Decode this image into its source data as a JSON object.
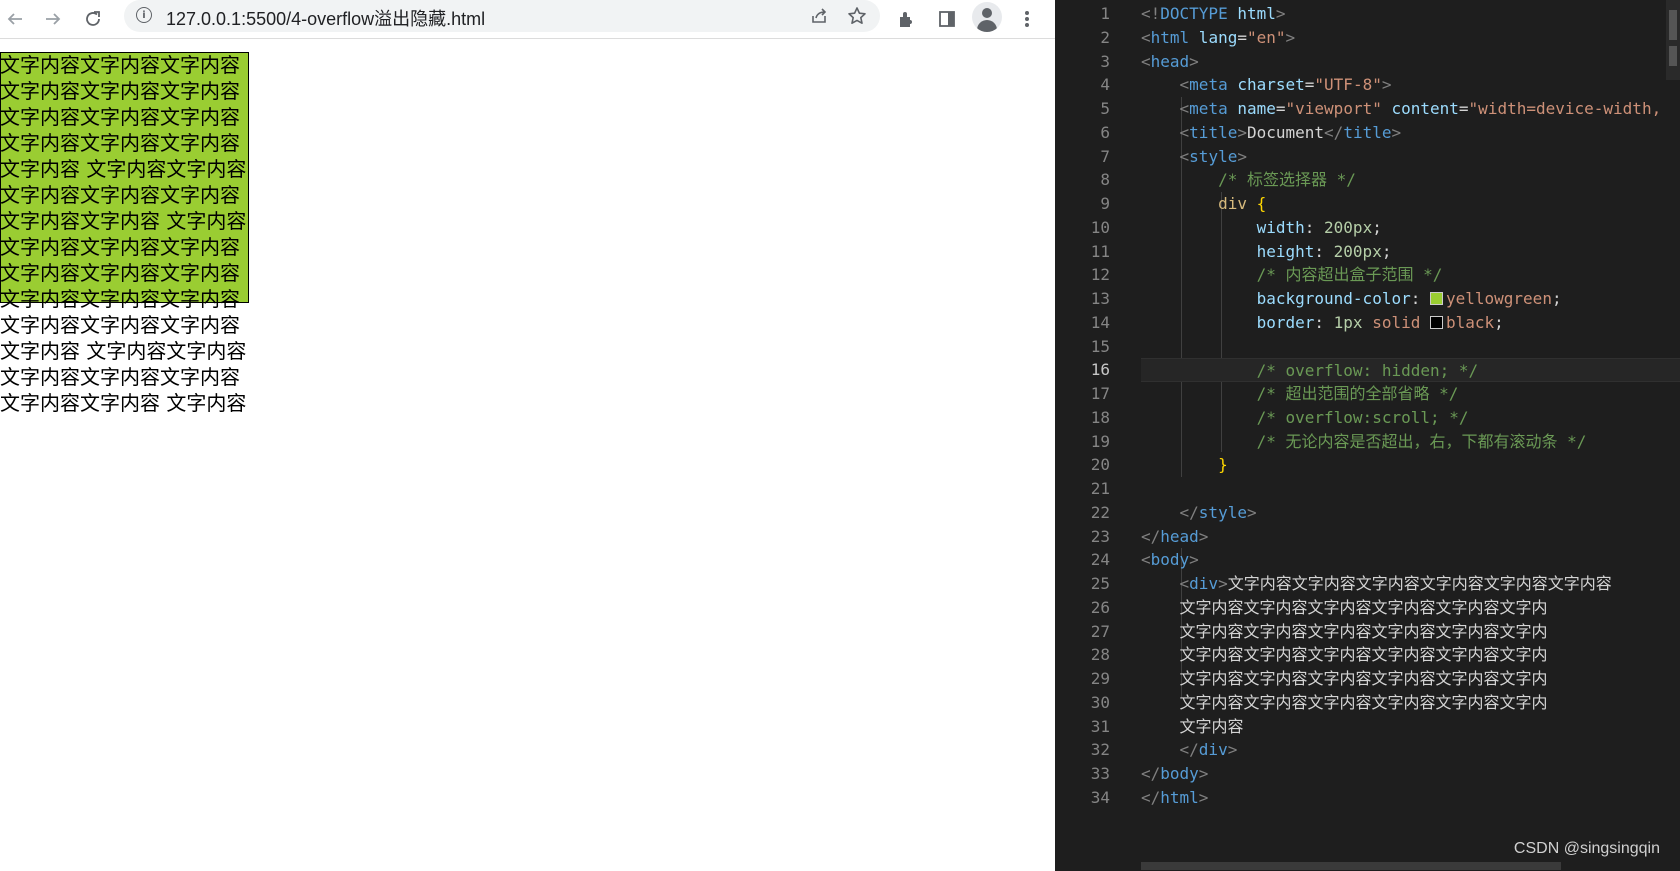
{
  "browser": {
    "url": "127.0.0.1:5500/4-overflow溢出隐藏.html",
    "page_lines": [
      "文字内容文字内容文字内容",
      "文字内容文字内容文字内容",
      "文字内容文字内容文字内容",
      "文字内容文字内容文字内容",
      "文字内容 文字内容文字内容",
      "文字内容文字内容文字内容",
      "文字内容文字内容 文字内容",
      "文字内容文字内容文字内容",
      "文字内容文字内容文字内容",
      "文字内容文字内容文字内容",
      "文字内容文字内容文字内容",
      "文字内容 文字内容文字内容",
      "文字内容文字内容文字内容",
      "文字内容文字内容 文字内容"
    ]
  },
  "editor": {
    "line_numbers": [
      "1",
      "2",
      "3",
      "4",
      "5",
      "6",
      "7",
      "8",
      "9",
      "10",
      "11",
      "12",
      "13",
      "14",
      "15",
      "16",
      "17",
      "18",
      "19",
      "20",
      "21",
      "22",
      "23",
      "24",
      "25",
      "26",
      "27",
      "28",
      "29",
      "30",
      "31",
      "32",
      "33",
      "34"
    ],
    "active_line": "16",
    "lines": {
      "l1": {
        "open": "<!",
        "tag": "DOCTYPE",
        "attr": " html",
        "close": ">"
      },
      "l2": {
        "open": "<",
        "tag": "html",
        "attr": " lang",
        "eq": "=",
        "str": "\"en\"",
        "close": ">"
      },
      "l3": {
        "open": "<",
        "tag": "head",
        "close": ">"
      },
      "l4": {
        "open": "<",
        "tag": "meta",
        "attr": " charset",
        "eq": "=",
        "str": "\"UTF-8\"",
        "close": ">"
      },
      "l5": {
        "open": "<",
        "tag": "meta",
        "attr": " name",
        "eq": "=",
        "str": "\"viewport\"",
        "attr2": " content",
        "eq2": "=",
        "str2": "\"width=device-width,"
      },
      "l6": {
        "open": "<",
        "tag": "title",
        "close": ">",
        "text": "Document",
        "open2": "</",
        "tag2": "title",
        "close2": ">"
      },
      "l7": {
        "open": "<",
        "tag": "style",
        "close": ">"
      },
      "l8": {
        "comment": "/* 标签选择器 */"
      },
      "l9": {
        "selector": "div",
        "brace": " {"
      },
      "l10": {
        "prop": "width",
        "colon": ": ",
        "num": "200px",
        "semi": ";"
      },
      "l11": {
        "prop": "height",
        "colon": ": ",
        "num": "200px",
        "semi": ";"
      },
      "l12": {
        "comment": "/* 内容超出盒子范围 */"
      },
      "l13": {
        "prop": "background-color",
        "colon": ": ",
        "val": "yellowgreen",
        "semi": ";",
        "swatch_color": "#9acd32"
      },
      "l14": {
        "prop": "border",
        "colon": ": ",
        "num": "1px",
        "val": " solid ",
        "val2": "black",
        "semi": ";",
        "swatch_color": "#000000"
      },
      "l16": {
        "comment": "/* overflow: hidden; */"
      },
      "l17": {
        "comment": "/* 超出范围的全部省略 */"
      },
      "l18": {
        "comment": "/* overflow:scroll; */"
      },
      "l19": {
        "comment": "/* 无论内容是否超出，右，下都有滚动条 */"
      },
      "l20": {
        "brace": "}"
      },
      "l22": {
        "open": "</",
        "tag": "style",
        "close": ">"
      },
      "l23": {
        "open": "</",
        "tag": "head",
        "close": ">"
      },
      "l24": {
        "open": "<",
        "tag": "body",
        "close": ">"
      },
      "l25": {
        "open": "<",
        "tag": "div",
        "close": ">",
        "text": "文字内容文字内容文字内容文字内容文字内容文字内容"
      },
      "l26": {
        "text": "文字内容文字内容文字内容文字内容文字内容文字内"
      },
      "l27": {
        "text": "文字内容文字内容文字内容文字内容文字内容文字内"
      },
      "l28": {
        "text": "文字内容文字内容文字内容文字内容文字内容文字内"
      },
      "l29": {
        "text": "文字内容文字内容文字内容文字内容文字内容文字内"
      },
      "l30": {
        "text": "文字内容文字内容文字内容文字内容文字内容文字内"
      },
      "l31": {
        "text": "文字内容"
      },
      "l32": {
        "open": "</",
        "tag": "div",
        "close": ">"
      },
      "l33": {
        "open": "</",
        "tag": "body",
        "close": ">"
      },
      "l34": {
        "open": "</",
        "tag": "html",
        "close": ">"
      }
    },
    "watermark": "CSDN @singsingqin"
  },
  "colors": {
    "box_background": "#9acd32",
    "editor_background": "#1e1e1e"
  },
  "icons": [
    "back-arrow-icon",
    "forward-arrow-icon",
    "reload-icon",
    "info-icon",
    "share-icon",
    "star-icon",
    "extensions-icon",
    "side-panel-icon",
    "profile-avatar",
    "menu-kebab-icon"
  ]
}
